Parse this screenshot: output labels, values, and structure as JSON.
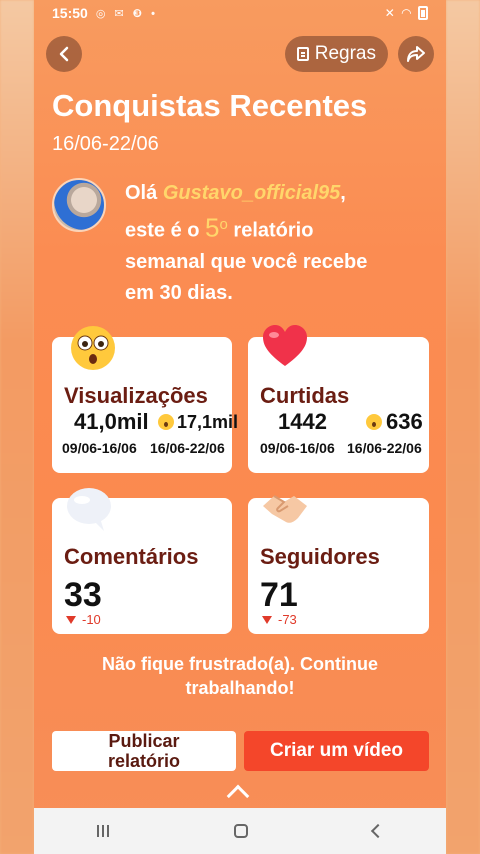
{
  "status": {
    "time": "15:50",
    "left_icons": "◎ ✉ ❸ •",
    "right_icons": "🔇 ᯤ ▮"
  },
  "header": {
    "rules_label": "Regras",
    "title": "Conquistas Recentes",
    "date_range": "16/06-22/06"
  },
  "greeting": {
    "hello": "Olá",
    "username": "Gustavo_official95",
    "comma": ",",
    "line2_pre": "este é o",
    "report_number": "5",
    "ordinal": "o",
    "line2_post": "relatório",
    "line3": "semanal que você recebe",
    "line4": "em 30 dias."
  },
  "stats": {
    "views": {
      "label": "Visualizações",
      "prev_value": "41,0mil",
      "curr_value": "17,1mil",
      "prev_range": "09/06-16/06",
      "curr_range": "16/06-22/06"
    },
    "likes": {
      "label": "Curtidas",
      "prev_value": "1442",
      "curr_value": "636",
      "prev_range": "09/06-16/06",
      "curr_range": "16/06-22/06"
    },
    "comments": {
      "label": "Comentários",
      "value": "33",
      "delta": "-10"
    },
    "followers": {
      "label": "Seguidores",
      "value": "71",
      "delta": "-73"
    }
  },
  "message": {
    "line1": "Não fique frustrado(a). Continue",
    "line2": "trabalhando!"
  },
  "actions": {
    "publish_line1": "Publicar",
    "publish_line2": "relatório",
    "create": "Criar um vídeo"
  },
  "icons": {
    "back": "chevron-left-icon",
    "share": "share-icon",
    "rules": "document-icon",
    "views_emoji": "surprised-face-icon",
    "likes_emoji": "heart-icon",
    "comments_emoji": "speech-bubble-icon",
    "followers_emoji": "handshake-icon"
  },
  "colors": {
    "accent": "#f4462a",
    "label": "#6b1d12",
    "highlight": "#ffd66b",
    "decline": "#e03a2a"
  }
}
